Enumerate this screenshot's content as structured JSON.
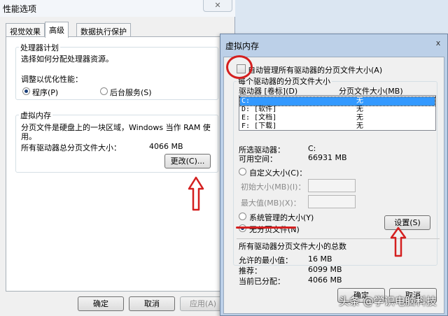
{
  "perf": {
    "title": "性能选项",
    "tabs": [
      "视觉效果",
      "高级",
      "数据执行保护"
    ],
    "processor": {
      "group_title": "处理器计划",
      "desc": "选择如何分配处理器资源。",
      "adjust_label": "调整以优化性能：",
      "opt_programs": "程序(P)",
      "opt_background": "后台服务(S)",
      "selected": "programs"
    },
    "vm": {
      "group_title": "虚拟内存",
      "desc": "分页文件是硬盘上的一块区域，Windows 当作 RAM 使用。",
      "desc_line1": "分页文件是硬盘上的一块区域，Windows 当作 RAM 使",
      "desc_line2": "用。",
      "total_label": "所有驱动器总分页文件大小：",
      "total_value": "4066 MB",
      "change_button": "更改(C)..."
    },
    "buttons": {
      "ok": "确定",
      "cancel": "取消",
      "apply": "应用(A)"
    }
  },
  "vmdlg": {
    "title": "虚拟内存",
    "close_glyph": "x",
    "auto_manage_label": "自动管理所有驱动器的分页文件大小(A)",
    "auto_manage_checked": false,
    "per_drive_group_title": "每个驱动器的分页文件大小",
    "drive_list": {
      "col_drive": "驱动器 [卷标](D)",
      "col_size": "分页文件大小(MB)",
      "rows": [
        {
          "drive": "C:",
          "size": "无",
          "selected": true
        },
        {
          "drive": "D:   [软件]",
          "size": "无",
          "selected": false
        },
        {
          "drive": "E:   [文档]",
          "size": "无",
          "selected": false
        },
        {
          "drive": "F:   [下载]",
          "size": "无",
          "selected": false
        }
      ]
    },
    "selected_drive_label": "所选驱动器：",
    "selected_drive_value": "C:",
    "free_space_label": "可用空间：",
    "free_space_value": "66931 MB",
    "custom_size_label": "自定义大小(C)：",
    "initial_size_label": "初始大小(MB)(I)：",
    "max_size_label": "最大值(MB)(X)：",
    "system_managed_label": "系统管理的大小(Y)",
    "no_paging_label": "无分页文件(N)",
    "paging_choice": "no_paging",
    "set_button": "设置(S)",
    "totals_group_title": "所有驱动器分页文件大小的总数",
    "min_allowed_label": "允许的最小值：",
    "min_allowed_value": "16 MB",
    "recommended_label": "推荐：",
    "recommended_value": "6099 MB",
    "current_label": "当前已分配：",
    "current_value": "4066 MB",
    "ok": "确定",
    "cancel": "取消"
  },
  "watermark": "头条 @学识电脑科技",
  "colors": {
    "annotation_red": "#d41f1f",
    "selection_blue": "#3399ff"
  }
}
